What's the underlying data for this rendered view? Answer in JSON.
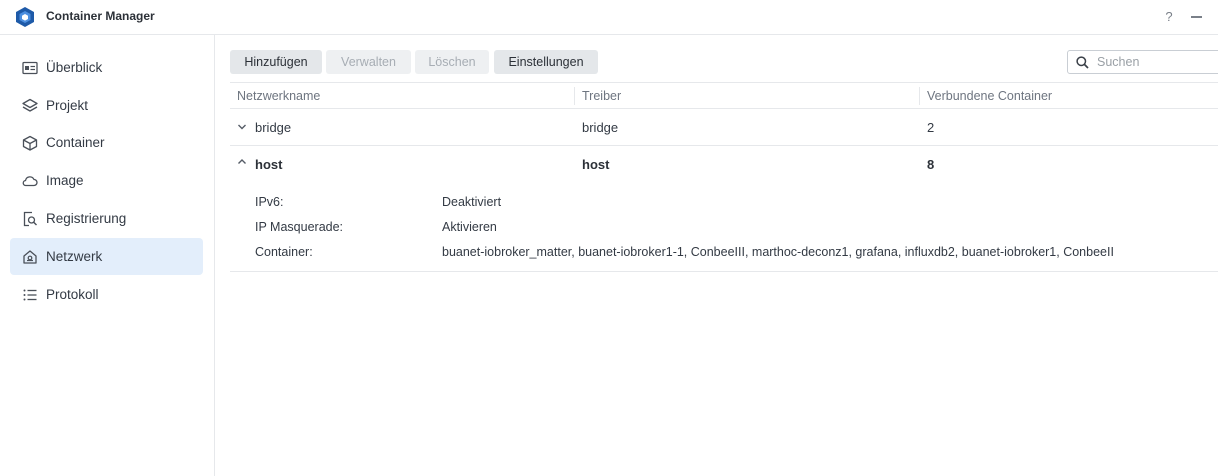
{
  "window": {
    "title": "Container Manager",
    "help_label": "?",
    "logo_icon": "container-manager-logo",
    "accent_color": "#1e5aa8"
  },
  "sidebar": {
    "items": [
      {
        "label": "Überblick",
        "icon": "overview-icon"
      },
      {
        "label": "Projekt",
        "icon": "layers-icon"
      },
      {
        "label": "Container",
        "icon": "cube-icon"
      },
      {
        "label": "Image",
        "icon": "cloud-icon"
      },
      {
        "label": "Registrierung",
        "icon": "registry-search-icon"
      },
      {
        "label": "Netzwerk",
        "icon": "network-home-icon",
        "active": true
      },
      {
        "label": "Protokoll",
        "icon": "list-icon"
      }
    ]
  },
  "toolbar": {
    "add_label": "Hinzufügen",
    "manage_label": "Verwalten",
    "delete_label": "Löschen",
    "settings_label": "Einstellungen"
  },
  "search": {
    "placeholder": "Suchen",
    "value": ""
  },
  "table": {
    "columns": [
      "Netzwerkname",
      "Treiber",
      "Verbundene Container"
    ],
    "rows": [
      {
        "name": "bridge",
        "driver": "bridge",
        "connected": "2",
        "expanded": false
      },
      {
        "name": "host",
        "driver": "host",
        "connected": "8",
        "expanded": true
      }
    ],
    "details": {
      "ipv6_label": "IPv6:",
      "ipv6_value": "Deaktiviert",
      "masquerade_label": "IP Masquerade:",
      "masquerade_value": "Aktivieren",
      "containers_label": "Container:",
      "containers_value": "buanet-iobroker_matter, buanet-iobroker1-1, ConbeeIII, marthoc-deconz1, grafana, influxdb2, buanet-iobroker1, ConbeeII"
    }
  }
}
